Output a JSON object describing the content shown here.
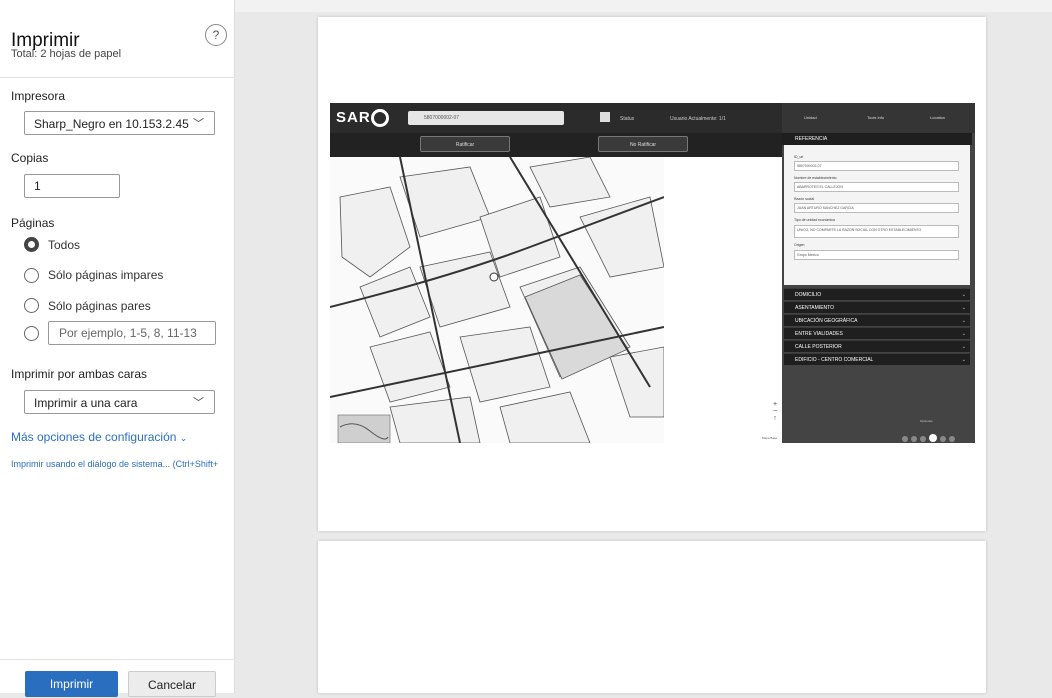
{
  "dialog": {
    "title": "Imprimir",
    "subtitle": "Total: 2 hojas de papel",
    "help_icon": "?"
  },
  "printer": {
    "label": "Impresora",
    "value": "Sharp_Negro en 10.153.2.45"
  },
  "copies": {
    "label": "Copias",
    "value": "1"
  },
  "pages": {
    "label": "Páginas",
    "options": [
      {
        "label": "Todos",
        "selected": true
      },
      {
        "label": "Sólo páginas impares",
        "selected": false
      },
      {
        "label": "Sólo páginas pares",
        "selected": false
      }
    ],
    "custom_placeholder": "Por ejemplo, 1-5, 8, 11-13"
  },
  "duplex": {
    "label": "Imprimir por ambas caras",
    "value": "Imprimir a una cara"
  },
  "more_options": "Más opciones de configuración",
  "system_dialog": "Imprimir usando el diálogo de sistema... (Ctrl+Shift+",
  "buttons": {
    "print": "Imprimir",
    "cancel": "Cancelar"
  },
  "preview": {
    "app_logo": "SAR",
    "search_value": "5807000002-07",
    "toggle_label": "Status",
    "toolbar_info": "Usuario Actualmente: 1/1",
    "btn_left": "Ratificar",
    "btn_right": "No Ratificar",
    "side_tabs": [
      "Unidad",
      "Tools Info",
      "Location"
    ],
    "reference_title": "REFERENCIA",
    "form": [
      {
        "label": "ID_uri",
        "value": "5807000002-07"
      },
      {
        "label": "Nombre de establecimiento",
        "value": "ABARROTES EL CALLEJON"
      },
      {
        "label": "Razón social",
        "value": "JUAN ARTURO SANCHEZ GARCIA"
      },
      {
        "label": "Tipo de unidad económica",
        "value": "UNICO, NO COMPARTE LA RAZON SOCIAL CON OTRO ESTABLECIMIENTO"
      },
      {
        "label": "Origen",
        "value": "Grupo Mexico"
      }
    ],
    "sections": [
      "DOMICILIO",
      "ASENTAMIENTO",
      "UBICACIÓN GEOGRÁFICA",
      "ENTRE VIALIDADES",
      "CALLE POSTERIOR",
      "EDIFICIO - CENTRO COMERCIAL"
    ],
    "map_footer": "Mapa Base",
    "tooltip": "Opciones",
    "zoom_in": "+",
    "zoom_out": "−",
    "compass": "↑"
  },
  "colors": {
    "accent": "#2a6fbf",
    "app_dark": "#2b2b2b"
  }
}
